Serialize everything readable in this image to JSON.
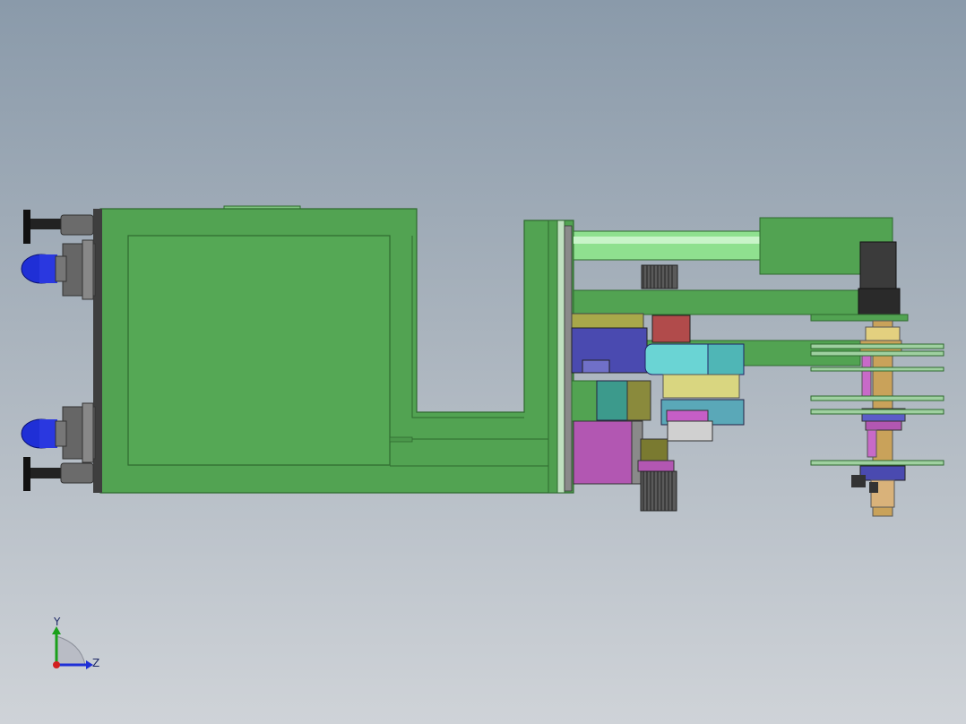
{
  "viewport": {
    "background_top": "#8a9aaa",
    "background_bottom": "#cfd3d8"
  },
  "model": {
    "description_colors": {
      "frame_green": "#52a352",
      "frame_dark": "#2f6a2f",
      "caster_blue": "#1f2fd6",
      "steel_gray": "#6b6b6b"
    }
  },
  "triad": {
    "y_label": "Y",
    "z_label": "Z",
    "y_color": "#1aa01a",
    "z_color": "#1f2fd6",
    "x_color": "#d21f1f"
  }
}
